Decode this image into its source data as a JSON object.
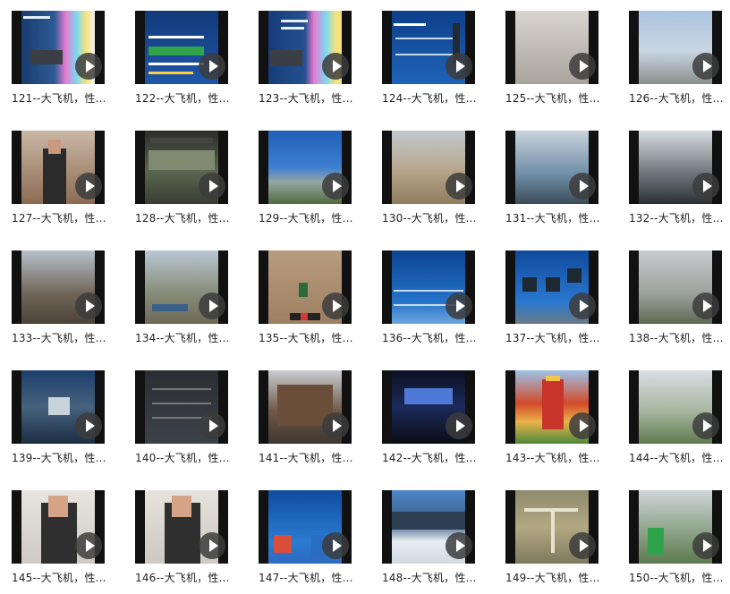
{
  "items": [
    {
      "caption": "121--大飞机，性...",
      "icon": "play-icon",
      "bg": "linear-gradient(90deg,#1b3c6e 0%,#2b5a94 45%,#e87ad0 60%,#7ad8f0 75%,#f6e27a 88%,#f3f3f3 100%)"
    },
    {
      "caption": "122--大飞机，性...",
      "icon": "play-icon",
      "bg": "linear-gradient(180deg,#123a7a 0%,#1f56a8 100%)"
    },
    {
      "caption": "123--大飞机，性...",
      "icon": "play-icon",
      "bg": "linear-gradient(90deg,#163c79 0%,#24508f 50%,#e87ad0 62%,#7ad8f0 78%,#f6e27a 92%)"
    },
    {
      "caption": "124--大飞机，性...",
      "icon": "play-icon",
      "bg": "linear-gradient(180deg,#0e3f8a 0%,#1e63b8 100%)"
    },
    {
      "caption": "125--大飞机，性...",
      "icon": "play-icon",
      "bg": "linear-gradient(180deg,#d8d4cf 0%,#a8a39d 100%)"
    },
    {
      "caption": "126--大飞机，性...",
      "icon": "play-icon",
      "bg": "linear-gradient(180deg,#aac4e0 0%,#c9d6e2 55%,#8a8f8d 100%)"
    },
    {
      "caption": "127--大飞机，性...",
      "icon": "play-icon",
      "bg": "linear-gradient(180deg,#c9b8a6 0%,#8c6b52 100%)"
    },
    {
      "caption": "128--大飞机，性...",
      "icon": "play-icon",
      "bg": "linear-gradient(180deg,#2c2c2c 0%,#5a6650 55%,#3a3d34 100%)"
    },
    {
      "caption": "129--大飞机，性...",
      "icon": "play-icon",
      "bg": "linear-gradient(180deg,#1f5fb6 0%,#3c7fd0 50%,#95a6a5 70%,#4f6b3c 100%)"
    },
    {
      "caption": "130--大飞机，性...",
      "icon": "play-icon",
      "bg": "linear-gradient(180deg,#c3c9cf 0%,#b7a58a 55%,#8f7c5e 100%)"
    },
    {
      "caption": "131--大飞机，性...",
      "icon": "play-icon",
      "bg": "linear-gradient(180deg,#c8d3dd 0%,#6f8ea6 60%,#3c4c58 100%)"
    },
    {
      "caption": "132--大飞机，性...",
      "icon": "play-icon",
      "bg": "linear-gradient(180deg,#d6dbe0 0%,#6c7378 60%,#2c3034 100%)"
    },
    {
      "caption": "133--大飞机，性...",
      "icon": "play-icon",
      "bg": "linear-gradient(180deg,#b8c1cb 0%,#6e6357 60%,#4e4338 100%)"
    },
    {
      "caption": "134--大飞机，性...",
      "icon": "play-icon",
      "bg": "linear-gradient(180deg,#b9c7d5 0%,#8a8f7e 55%,#6d6a55 100%)"
    },
    {
      "caption": "135--大飞机，性...",
      "icon": "play-icon",
      "bg": "linear-gradient(180deg,#b89c7e 0%,#9e7f62 100%)"
    },
    {
      "caption": "136--大飞机，性...",
      "icon": "play-icon",
      "bg": "linear-gradient(180deg,#0d4592 0%,#2472c9 70%,#6ea6de 100%)"
    },
    {
      "caption": "137--大飞机，性...",
      "icon": "play-icon",
      "bg": "linear-gradient(180deg,#0f4a9c 0%,#2a78d0 70%,#6b7a84 100%)"
    },
    {
      "caption": "138--大飞机，性...",
      "icon": "play-icon",
      "bg": "linear-gradient(180deg,#c8ccd0 0%,#9aa09a 60%,#5e6a52 100%)"
    },
    {
      "caption": "139--大飞机，性...",
      "icon": "play-icon",
      "bg": "linear-gradient(180deg,#1b3e6c 0%,#47627d 50%,#1b2d44 100%)"
    },
    {
      "caption": "140--大飞机，性...",
      "icon": "play-icon",
      "bg": "linear-gradient(180deg,#2a2e33 0%,#3d4249 100%)"
    },
    {
      "caption": "141--大飞机，性...",
      "icon": "play-icon",
      "bg": "linear-gradient(180deg,#c9cdd1 0%,#6e5a4a 55%,#3d3630 100%)"
    },
    {
      "caption": "142--大飞机，性...",
      "icon": "play-icon",
      "bg": "linear-gradient(180deg,#0b1022 0%,#1c2a5a 50%,#0a0c14 100%)"
    },
    {
      "caption": "143--大飞机，性...",
      "icon": "play-icon",
      "bg": "linear-gradient(180deg,#9cc2e8 0%,#d24a2a 45%,#e9b24a 70%,#4d8a3a 100%)"
    },
    {
      "caption": "144--大飞机，性...",
      "icon": "play-icon",
      "bg": "linear-gradient(180deg,#d8dfe6 0%,#a7b6a0 55%,#5f7b4f 100%)"
    },
    {
      "caption": "145--大飞机，性...",
      "icon": "play-icon",
      "bg": "linear-gradient(180deg,#e7e4df 0%,#cfcac3 100%)"
    },
    {
      "caption": "146--大飞机，性...",
      "icon": "play-icon",
      "bg": "linear-gradient(180deg,#e6e3dd 0%,#cdc8c0 100%)"
    },
    {
      "caption": "147--大飞机，性...",
      "icon": "play-icon",
      "bg": "linear-gradient(180deg,#0f4c9f 0%,#2a7bd1 70%,#2d6ac0 100%)"
    },
    {
      "caption": "148--大飞机，性...",
      "icon": "play-icon",
      "bg": "linear-gradient(180deg,#4d86c7 0%,#3a5e88 45%,#e8eef3 70%,#cfd9e2 100%)"
    },
    {
      "caption": "149--大飞机，性...",
      "icon": "play-icon",
      "bg": "linear-gradient(180deg,#8e8a6b 0%,#b2a883 50%,#7e7a5e 100%)"
    },
    {
      "caption": "150--大飞机，性...",
      "icon": "play-icon",
      "bg": "linear-gradient(180deg,#cfd6d9 0%,#8fa48a 55%,#5c7a4e 100%)"
    }
  ]
}
